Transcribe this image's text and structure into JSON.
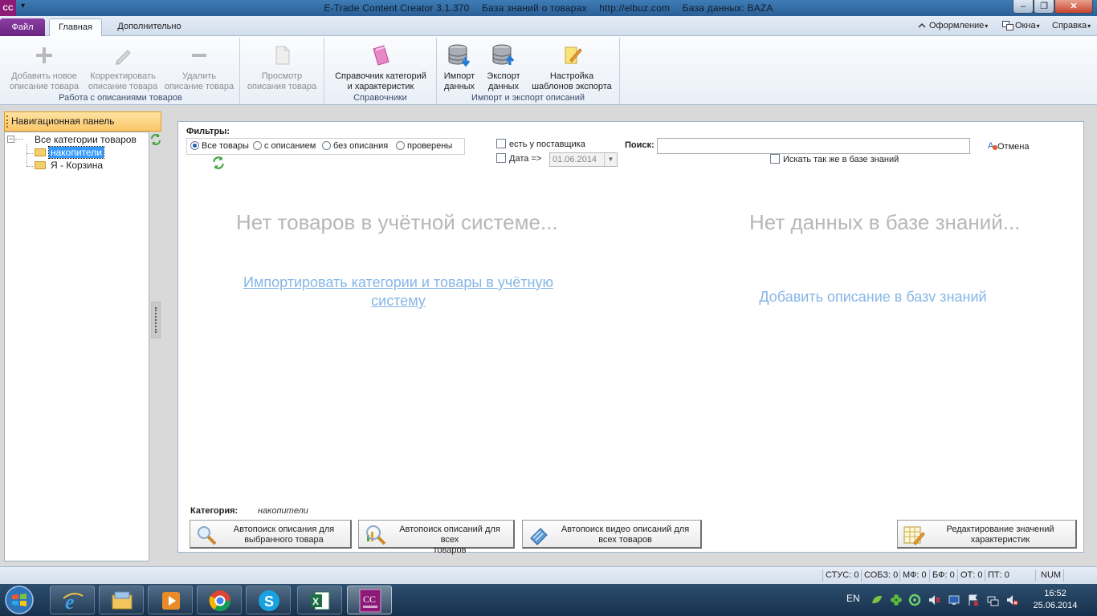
{
  "titlebar": {
    "app_icon": "CC",
    "title_parts": [
      "E-Trade Content Creator 3.1.370",
      "База знаний о товарах",
      "http://elbuz.com",
      "База данных: BAZA"
    ]
  },
  "ribbon_tabs": {
    "file": "Файл",
    "home": "Главная",
    "extra": "Дополнительно",
    "menu_design": "Оформление",
    "menu_windows": "Окна",
    "menu_help": "Справка"
  },
  "ribbon": {
    "groups": {
      "descriptions": "Работа с описаниями товаров",
      "references": "Справочники",
      "import_export": "Импорт и экспорт описаний"
    },
    "buttons": {
      "add": "Добавить новое\nописание товара",
      "edit": "Корректировать\nописание товара",
      "delete": "Удалить\nописание товара",
      "view": "Просмотр\nописания товара",
      "catalog": "Справочник категорий\nи характеристик",
      "import": "Импорт\nданных",
      "export": "Экспорт\nданных",
      "export_templates": "Настройка\nшаблонов экспорта"
    }
  },
  "nav": {
    "header": "Навигационная панель",
    "tree": {
      "root": "Все категории товаров",
      "children": [
        "накопители",
        "Я - Корзина"
      ],
      "selected": "накопители"
    }
  },
  "filters": {
    "label": "Фильтры:",
    "radios": [
      "Все товары",
      "с описанием",
      "без описания",
      "проверены"
    ],
    "selected_radio": "Все товары",
    "supplier_check": "есть у поставщика",
    "date_check": "Дата =>",
    "date_value": "01.06.2014",
    "search_label": "Поиск:",
    "search_value": "",
    "search_kb_check": "Искать так же в базе знаний",
    "cancel": "Отмена"
  },
  "messages": {
    "no_goods": "Нет товаров в учётной системе...",
    "no_kb": "Нет данных в базе знаний...",
    "import_link": "Импортировать категории и товары в учётную систему",
    "add_kb_link": "Добавить описание в базv знаний"
  },
  "category": {
    "label": "Категория:",
    "value": "накопители"
  },
  "actions": {
    "autosearch_selected": "Автопоиск описания для\nвыбранного товара",
    "autosearch_all": "Автопоиск описаний для всех\nтоваров",
    "autosearch_video": "Автопоиск видео описаний для\nвсех товаров",
    "edit_values": "Редактирование значений\nхарактеристик"
  },
  "statusbar": {
    "items": [
      "СТУС: 0",
      "СОБЗ: 0",
      "МФ: 0",
      "БФ: 0",
      "ОТ: 0",
      "ПТ: 0",
      "NUM"
    ]
  },
  "taskbar": {
    "language": "EN",
    "time": "16:52",
    "date": "25.06.2014",
    "apps": [
      "internet-explorer",
      "file-explorer",
      "media-player",
      "chrome",
      "skype",
      "excel",
      "etrade-content-creator"
    ]
  },
  "colors": {
    "accent_purple": "#7a2e93",
    "nav_header": "#fbc76a",
    "link": "#87b6e6",
    "placeholder_text": "#b7b7b7"
  }
}
